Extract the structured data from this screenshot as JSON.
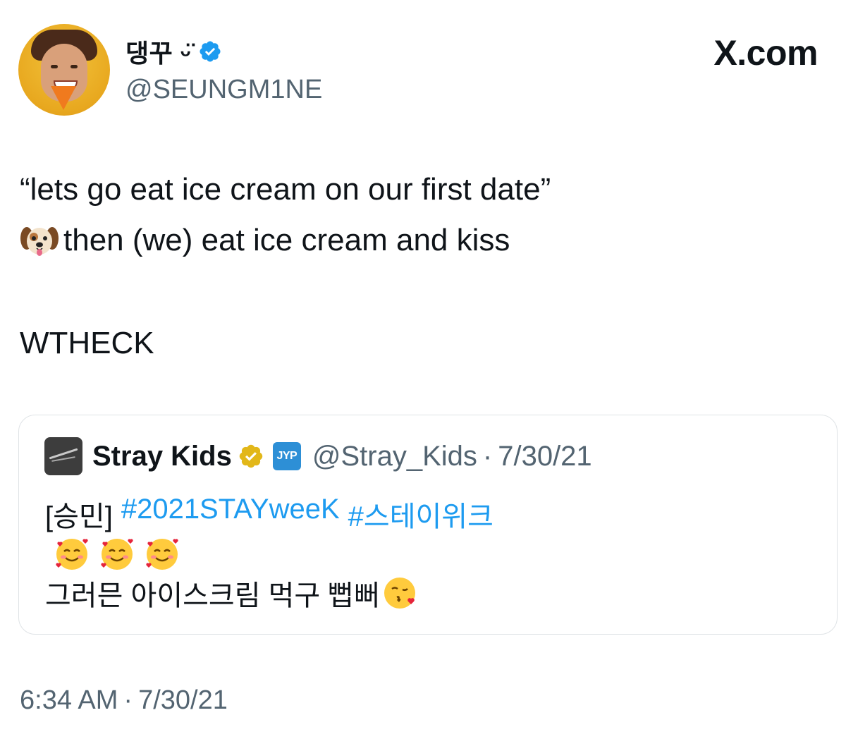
{
  "author": {
    "display_name": "댕꾸 ᵕ̈",
    "handle": "@SEUNGM1NE",
    "verified": true
  },
  "site": {
    "label": "X.com"
  },
  "tweet": {
    "line1": "“lets go eat ice cream on our first date”",
    "line2_emoji": "dog-face-icon",
    "line2_text": "then (we) eat ice cream and kiss",
    "line3": "WTHECK"
  },
  "quote": {
    "name": "Stray Kids",
    "affiliate_badge": "JYP",
    "handle": "@Stray_Kids",
    "separator": "·",
    "date": "7/30/21",
    "prefix": "[승민]",
    "hashtags": [
      "#2021STAYweeK",
      "#스테이위크"
    ],
    "emoji_row": [
      "smiling-face-with-hearts-icon",
      "smiling-face-with-hearts-icon",
      "smiling-face-with-hearts-icon"
    ],
    "last_line": "그러믄 아이스크림 먹구 뻡뻐",
    "last_emoji": "face-blowing-kiss-icon"
  },
  "meta": {
    "time": "6:34 AM",
    "separator": "·",
    "date": "7/30/21"
  },
  "colors": {
    "link": "#1d9bf0",
    "secondary_text": "#536471",
    "verified_blue": "#1d9bf0",
    "verified_gold": "#e2b719"
  }
}
